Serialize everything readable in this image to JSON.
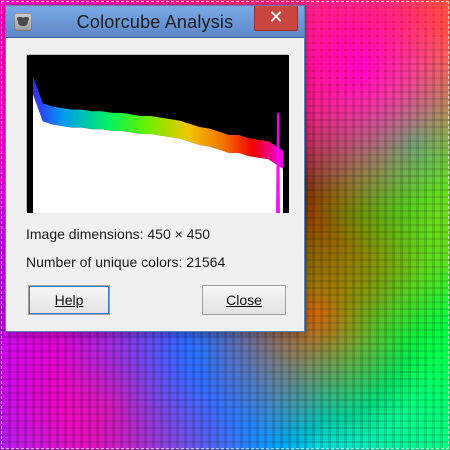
{
  "window": {
    "title": "Colorcube Analysis",
    "close_glyph": "✕"
  },
  "analysis": {
    "image_dimensions_line": "Image dimensions: 450 × 450",
    "unique_colors_line": "Number of unique colors: 21564"
  },
  "buttons": {
    "help_label": "Help",
    "close_label": "Close"
  },
  "chart_data": {
    "type": "area",
    "title": "",
    "xlabel": "",
    "ylabel": "",
    "x": [
      0,
      10,
      20,
      30,
      40,
      50,
      60,
      70,
      80,
      90,
      100,
      110,
      120,
      130,
      140,
      150,
      160,
      170,
      180,
      190,
      200,
      210,
      220,
      230,
      240,
      250,
      255
    ],
    "values": [
      0.75,
      0.58,
      0.56,
      0.55,
      0.54,
      0.54,
      0.53,
      0.53,
      0.52,
      0.52,
      0.51,
      0.5,
      0.5,
      0.49,
      0.48,
      0.47,
      0.45,
      0.43,
      0.42,
      0.4,
      0.38,
      0.38,
      0.36,
      0.35,
      0.34,
      0.3,
      0.28
    ],
    "colors": {
      "background": "#000000",
      "fill": "#ffffff",
      "spectrum": [
        "#3b2bff",
        "#00a2ff",
        "#00ff6a",
        "#6aff00",
        "#ffd000",
        "#ff7a00",
        "#ff0000",
        "#ff00ff"
      ]
    },
    "ylim": [
      0,
      1
    ],
    "grid": false
  },
  "icons": {
    "app": "gimp-icon",
    "close": "close-icon"
  }
}
